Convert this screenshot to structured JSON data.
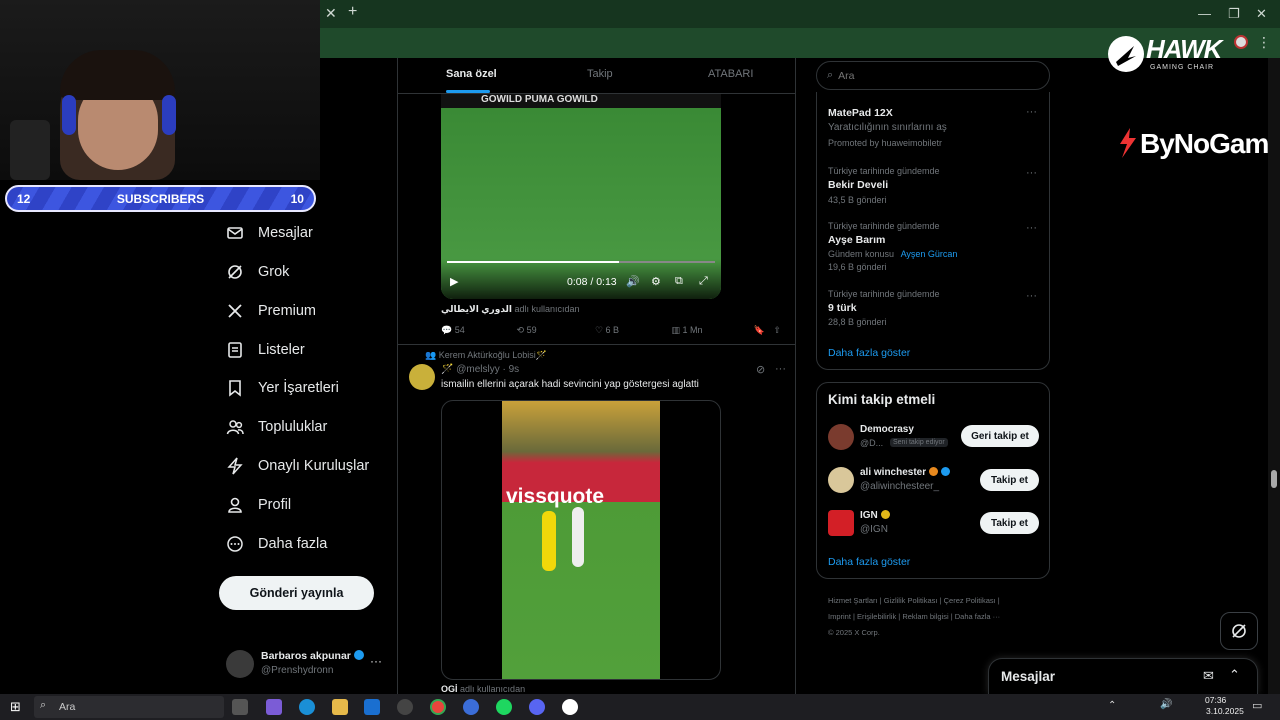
{
  "webcam": {
    "subs_left": "12",
    "subs_label": "SUBSCRIBERS",
    "subs_right": "10"
  },
  "brand": {
    "hawk": "HAWK",
    "hawk_sub": "GAMING CHAIR",
    "bynogame": "ByNoGame"
  },
  "nav": {
    "items": [
      {
        "label": "Mesajlar",
        "icon": "mail-icon"
      },
      {
        "label": "Grok",
        "icon": "grok-icon"
      },
      {
        "label": "Premium",
        "icon": "x-logo-icon"
      },
      {
        "label": "Listeler",
        "icon": "list-icon"
      },
      {
        "label": "Yer İşaretleri",
        "icon": "bookmark-icon"
      },
      {
        "label": "Topluluklar",
        "icon": "people-icon"
      },
      {
        "label": "Onaylı Kuruluşlar",
        "icon": "lightning-icon"
      },
      {
        "label": "Profil",
        "icon": "person-icon"
      },
      {
        "label": "Daha fazla",
        "icon": "more-circle-icon"
      }
    ],
    "post_button": "Gönderi yayınla",
    "user_name": "Barbaros akpunar",
    "user_handle": "@Prenshydronn"
  },
  "feed": {
    "tabs": [
      "Sana özel",
      "Takip",
      "ATABARI"
    ],
    "video1": {
      "time": "0:08 / 0:13",
      "caption": "الدوري الايطالي",
      "caption_suffix": "adlı kullanıcıdan",
      "banner": "GOWILD  PUMA  GOWILD"
    },
    "stats1": {
      "replies": "54",
      "reposts": "59",
      "likes": "6 B",
      "views": "1 Mn"
    },
    "post2": {
      "context": "Kerem Aktürkoğlu Lobisi🪄",
      "handle": "🪄 @melslyy · 9s",
      "text": "ismailin ellerini açarak hadi sevincini yap göstergesi aglatti",
      "ad_board": "vissquote",
      "footer_name": "OGİ",
      "footer_suffix": "adlı kullanıcıdan"
    }
  },
  "right": {
    "search_placeholder": "Ara",
    "promo": {
      "title": "MatePad 12X",
      "subtitle": "Yaratıcılığının sınırlarını aş",
      "promoted": "Promoted by huaweimobiletr"
    },
    "trends": [
      {
        "category": "Türkiye tarihinde gündemde",
        "name": "Bekir Develi",
        "meta": "43,5 B gönderi"
      },
      {
        "category": "Türkiye tarihinde gündemde",
        "name": "Ayşe Barım",
        "topic": "Gündem konusu",
        "topic_link": "Ayşen Gürcan",
        "meta": "19,6 B gönderi"
      },
      {
        "category": "Türkiye tarihinde gündemde",
        "name": "9 türk",
        "meta": "28,8 B gönderi"
      }
    ],
    "show_more_trends": "Daha fazla göster",
    "who_to_follow_title": "Kimi takip etmeli",
    "suggestions": [
      {
        "name": "Democrasy",
        "handle": "@D...",
        "badge": "Seni takip ediyor",
        "button": "Geri takip et"
      },
      {
        "name": "ali winchester",
        "handle": "@aliwinchesteer_",
        "button": "Takip et"
      },
      {
        "name": "IGN",
        "handle": "@IGN",
        "button": "Takip et"
      }
    ],
    "show_more_follow": "Daha fazla göster",
    "footer": [
      "Hizmet Şartları",
      "Gizlilik Politikası",
      "Çerez Politikası",
      "Imprint",
      "Erişilebilirlik",
      "Reklam bilgisi",
      "Daha fazla ···",
      "© 2025 X Corp."
    ],
    "messages_drawer": "Mesajlar"
  },
  "taskbar": {
    "search": "Ara",
    "time": "07:36",
    "date": "3.10.2025"
  },
  "colors": {
    "accent": "#1d9bf0",
    "chrome_green": "#1f4a2b",
    "subs_blue": "#3d56e0"
  }
}
